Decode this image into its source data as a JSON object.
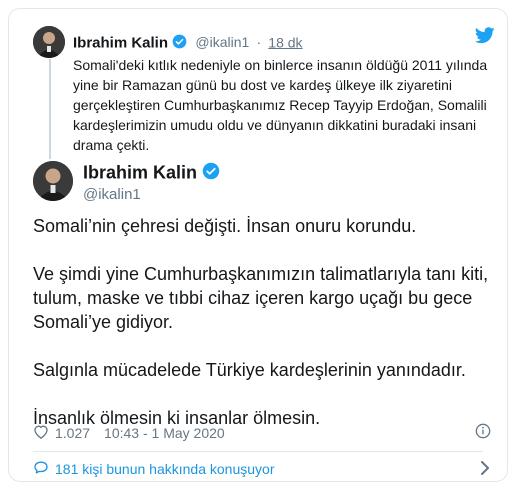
{
  "quoted_tweet": {
    "name": "Ibrahim Kalin",
    "handle": "@ikalin1",
    "separator": "·",
    "time": "18 dk",
    "text": "Somali'deki kıtlık nedeniyle on binlerce insanın öldüğü 2011 yılında yine bir Ramazan günü bu dost ve kardeş ülkeye ilk ziyaretini gerçekleştiren Cumhurbaşkanımız Recep Tayyip Erdoğan, Somalili kardeşlerimizin umudu oldu ve dünyanın dikkatini buradaki insani drama çekti."
  },
  "main_tweet": {
    "name": "Ibrahim Kalin",
    "handle": "@ikalin1",
    "paragraphs": [
      "Somali’nin çehresi değişti. İnsan onuru korundu.",
      "Ve şimdi yine Cumhurbaşkanımızın talimatlarıyla tanı kiti, tulum, maske ve tıbbi cihaz içeren kargo uçağı bu gece Somali’ye gidiyor.",
      "Salgınla mücadelede Türkiye kardeşlerinin yanındadır.",
      "İnsanlık ölmesin ki insanlar ölmesin."
    ],
    "likes": "1.027",
    "timestamp": "10:43 - 1 May 2020",
    "conversation_label": "181 kişi bunun hakkında konuşuyor"
  },
  "icons": {
    "brand": "twitter-bird-icon",
    "verified": "verified-badge-icon",
    "like": "heart-icon",
    "info": "info-icon",
    "reply": "speech-bubble-icon",
    "chevron": "chevron-right-icon"
  },
  "colors": {
    "brand_blue": "#1da1f2",
    "link_blue": "#1b95e0",
    "muted": "#657786",
    "like_red": "#e0245e"
  }
}
